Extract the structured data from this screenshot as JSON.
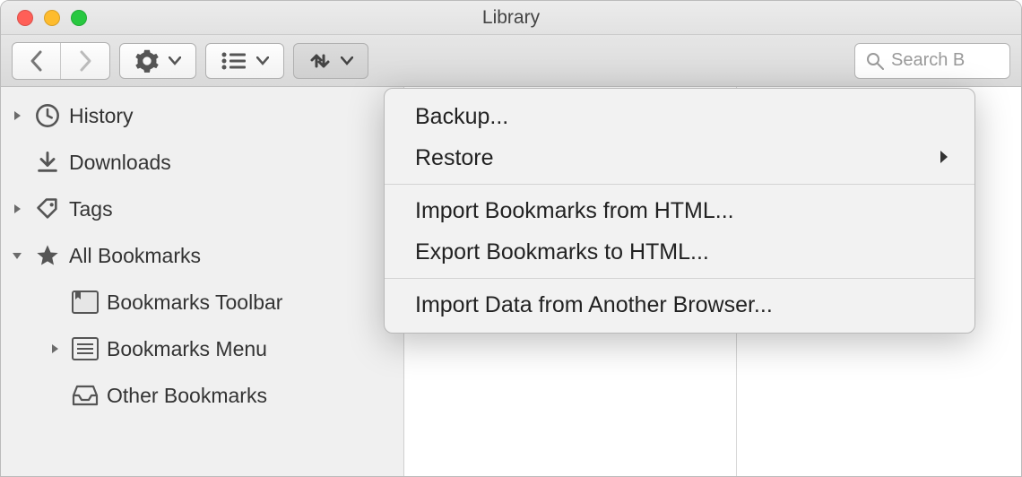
{
  "window": {
    "title": "Library"
  },
  "toolbar": {},
  "search": {
    "placeholder": "Search B"
  },
  "sidebar": {
    "items": [
      {
        "label": "History"
      },
      {
        "label": "Downloads"
      },
      {
        "label": "Tags"
      },
      {
        "label": "All Bookmarks"
      }
    ],
    "bookmark_children": [
      {
        "label": "Bookmarks Toolbar"
      },
      {
        "label": "Bookmarks Menu"
      },
      {
        "label": "Other Bookmarks"
      }
    ]
  },
  "menu": {
    "items": [
      {
        "label": "Backup..."
      },
      {
        "label": "Restore"
      },
      {
        "label": "Import Bookmarks from HTML..."
      },
      {
        "label": "Export Bookmarks to HTML..."
      },
      {
        "label": "Import Data from Another Browser..."
      }
    ]
  }
}
